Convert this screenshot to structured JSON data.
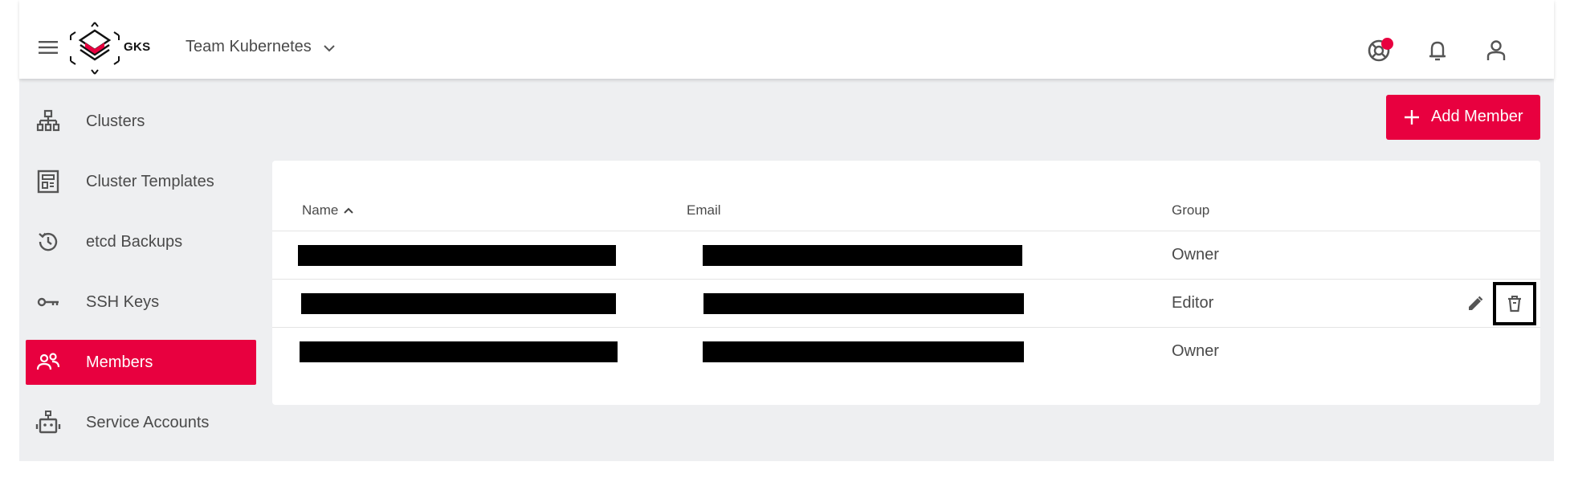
{
  "header": {
    "brand": "GKS",
    "project_name": "Team Kubernetes",
    "icons": [
      "menu-icon",
      "gks-logo",
      "chevron-down-icon",
      "support-icon",
      "bell-icon",
      "account-icon"
    ],
    "notification_dot_color": "#e8003f"
  },
  "sidebar": {
    "items": [
      {
        "label": "Clusters",
        "icon": "cluster-hierarchy-icon",
        "active": false
      },
      {
        "label": "Cluster Templates",
        "icon": "template-icon",
        "active": false
      },
      {
        "label": "etcd Backups",
        "icon": "history-icon",
        "active": false
      },
      {
        "label": "SSH Keys",
        "icon": "key-icon",
        "active": false
      },
      {
        "label": "Members",
        "icon": "members-icon",
        "active": true
      },
      {
        "label": "Service Accounts",
        "icon": "robot-icon",
        "active": false
      }
    ]
  },
  "toolbar": {
    "add_member_label": "Add Member"
  },
  "members_table": {
    "columns": [
      {
        "label": "Name",
        "sort": "ascending",
        "sort_icon": "chevron-up-icon"
      },
      {
        "label": "Email"
      },
      {
        "label": "Group"
      }
    ],
    "rows": [
      {
        "name": "[redacted]",
        "email": "[redacted]",
        "group": "Owner",
        "actions_visible": false
      },
      {
        "name": "[redacted]",
        "email": "[redacted]",
        "group": "Editor",
        "actions_visible": true
      },
      {
        "name": "[redacted]",
        "email": "[redacted]",
        "group": "Owner",
        "actions_visible": false
      }
    ],
    "row_actions": [
      "edit-icon",
      "delete-icon"
    ]
  },
  "colors": {
    "accent": "#e8003f",
    "content_background": "#eeeff1",
    "text": "#4a4a4a"
  }
}
